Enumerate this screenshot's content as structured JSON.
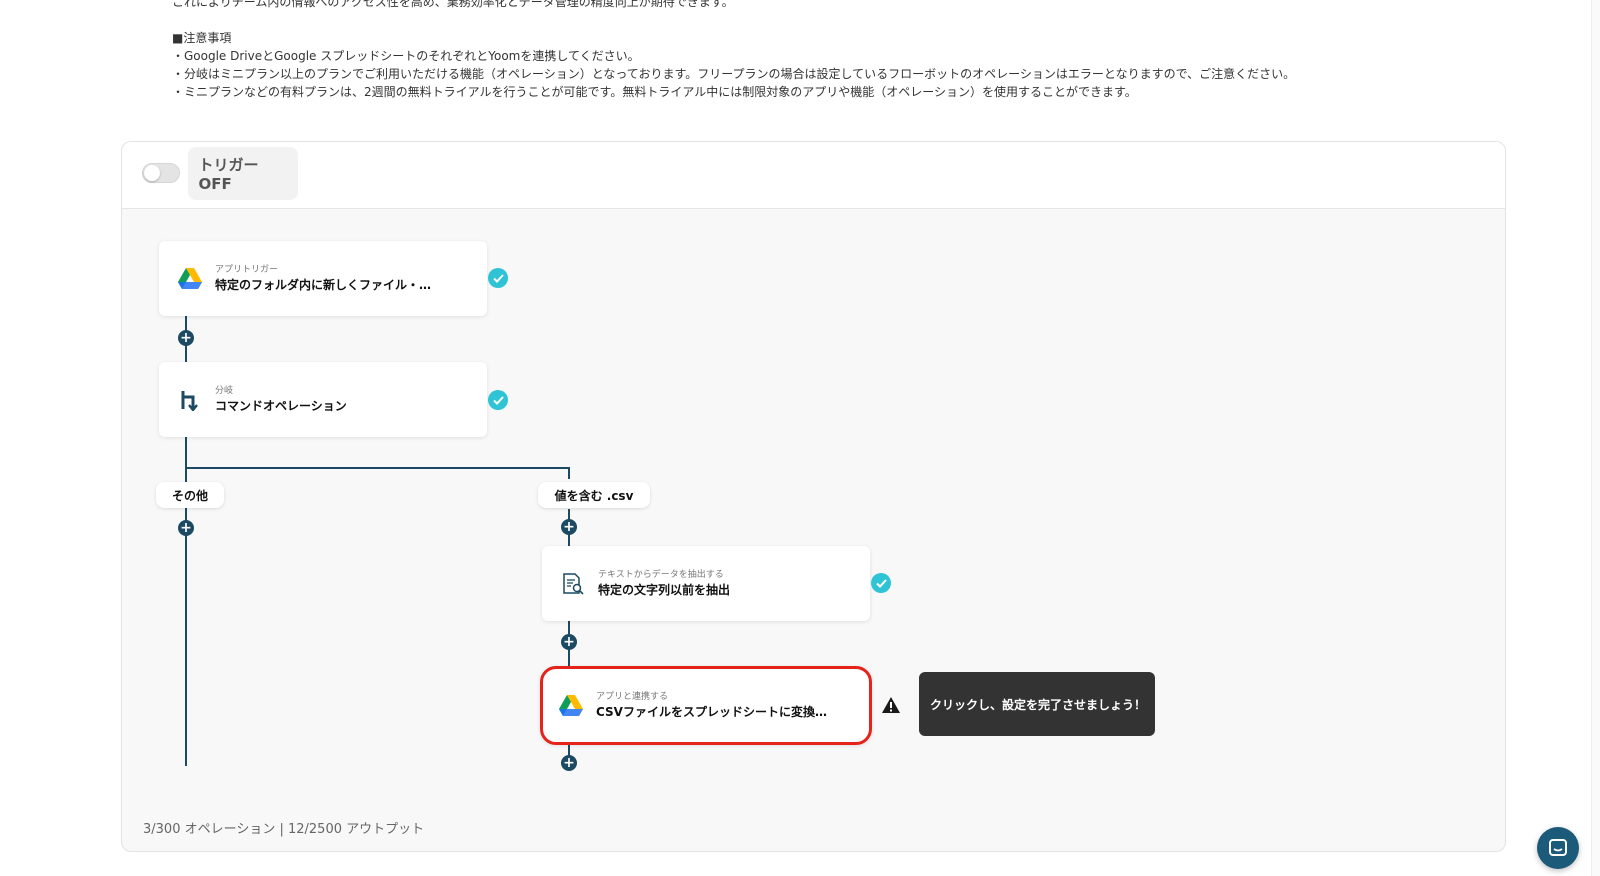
{
  "description": {
    "lines": [
      "これによりチーム内の情報へのアクセス性を高め、業務効率化とデータ管理の精度向上が期待できます。",
      "",
      "■注意事項",
      "・Google DriveとGoogle スプレッドシートのそれぞれとYoomを連携してください。",
      "・分岐はミニプラン以上のプランでご利用いただける機能（オペレーション）となっております。フリープランの場合は設定しているフローボットのオペレーションはエラーとなりますので、ご注意ください。",
      "・ミニプランなどの有料プランは、2週間の無料トライアルを行うことが可能です。無料トライアル中には制限対象のアプリや機能（オペレーション）を使用することができます。"
    ]
  },
  "panel": {
    "trigger_label": "トリガーOFF",
    "trigger_on": false,
    "footer": "3/300 オペレーション | 12/2500 アウトプット"
  },
  "flow": {
    "nodes": [
      {
        "type": "アプリトリガー",
        "title": "特定のフォルダ内に新しくファイル・…",
        "icon": "google-drive-icon",
        "status": "complete"
      },
      {
        "type": "分岐",
        "title": "コマンドオペレーション",
        "icon": "branch-icon",
        "status": "complete"
      },
      {
        "type": "テキストからデータを抽出する",
        "title": "特定の文字列以前を抽出",
        "icon": "text-extract-icon",
        "status": "complete"
      },
      {
        "type": "アプリと連携する",
        "title": "CSVファイルをスプレッドシートに変換…",
        "icon": "google-drive-icon",
        "status": "warning"
      }
    ],
    "branches": {
      "left": "その他",
      "right": "値を含む .csv"
    },
    "tooltip": "クリックし、設定を完了させましょう！"
  },
  "colors": {
    "accent": "#1d4a63",
    "check": "#2ec4d6",
    "highlight": "#e5231b"
  }
}
